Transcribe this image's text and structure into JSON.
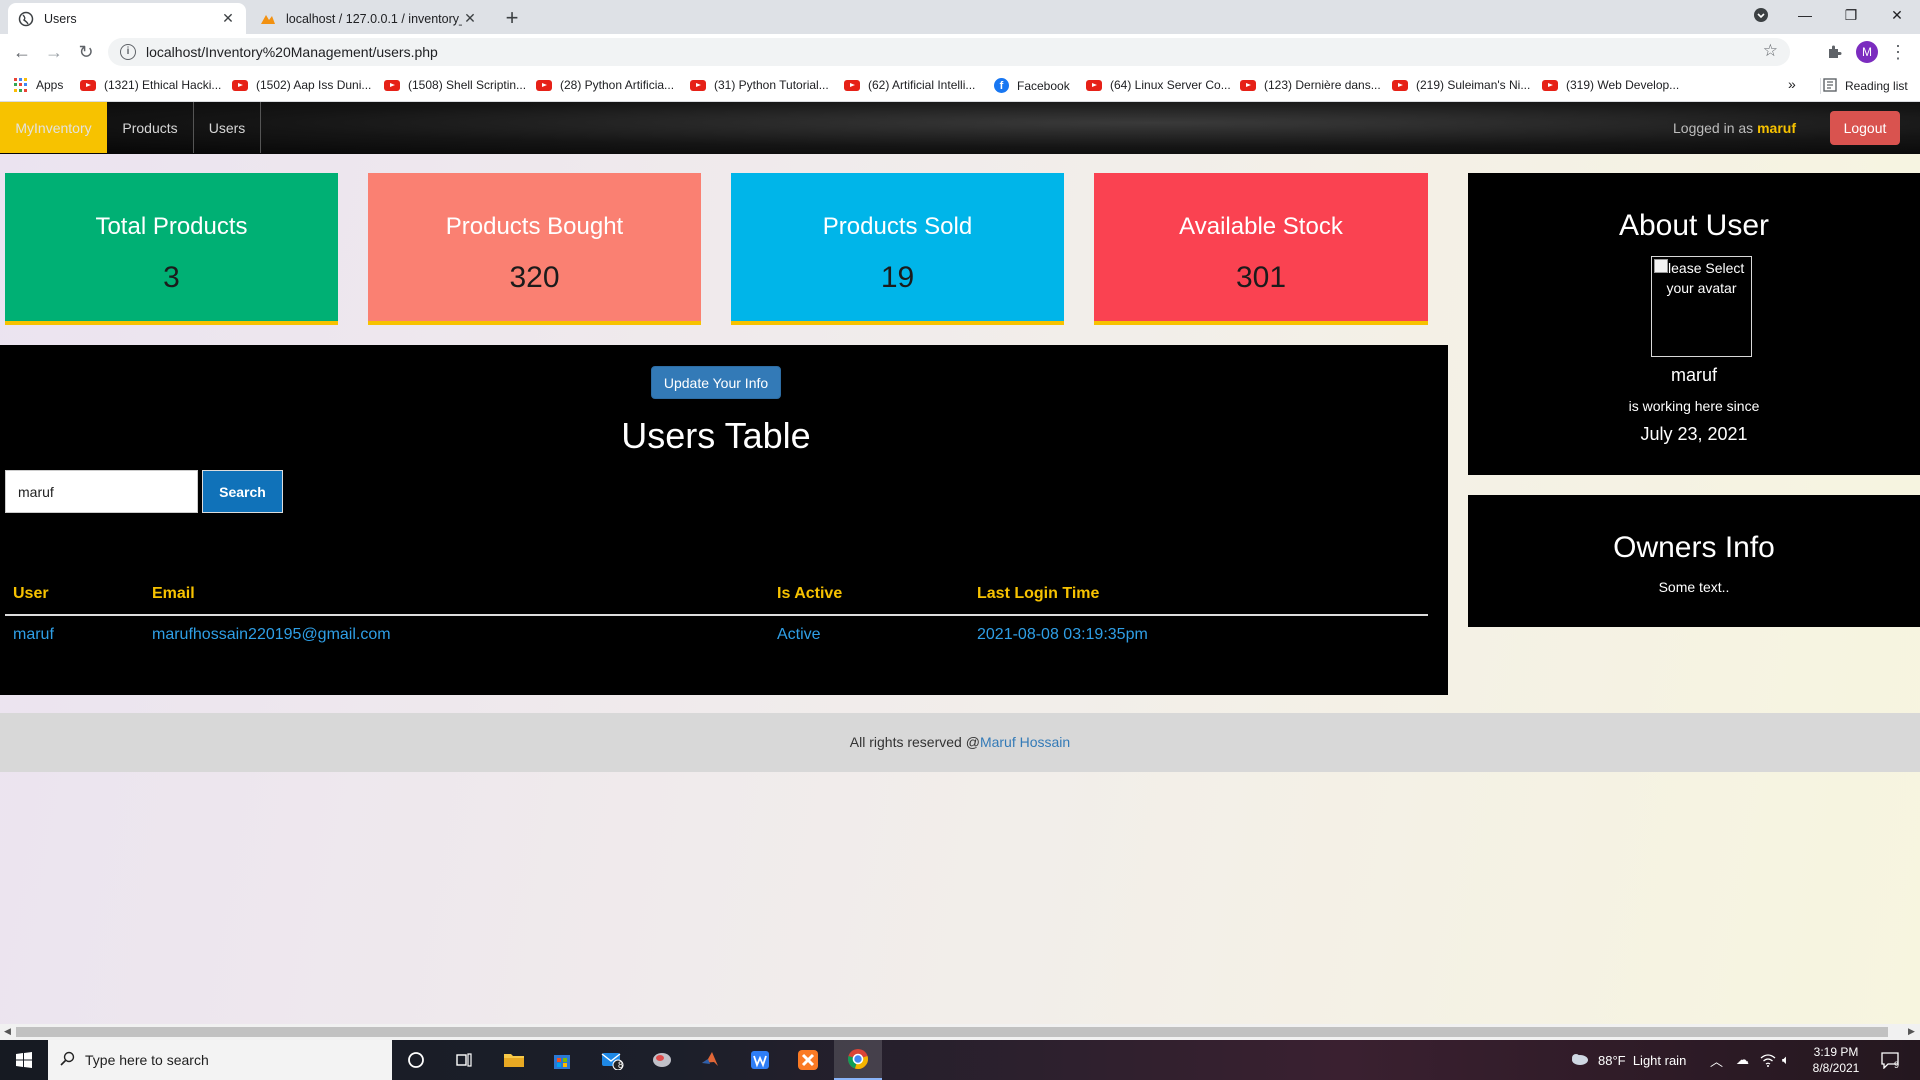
{
  "browser": {
    "tabs": [
      {
        "title": "Users",
        "active": true
      },
      {
        "title": "localhost / 127.0.0.1 / inventory_",
        "active": false
      }
    ],
    "url": "localhost/Inventory%20Management/users.php",
    "profile_initial": "M",
    "bookmarks": [
      {
        "label": "Apps",
        "icon": "apps-grid-icon"
      },
      {
        "label": "(1321) Ethical Hacki...",
        "icon": "youtube-icon"
      },
      {
        "label": "(1502) Aap Iss Duni...",
        "icon": "youtube-icon"
      },
      {
        "label": "(1508) Shell Scriptin...",
        "icon": "youtube-icon"
      },
      {
        "label": "(28) Python Artificia...",
        "icon": "youtube-icon"
      },
      {
        "label": "(31) Python Tutorial...",
        "icon": "youtube-icon"
      },
      {
        "label": "(62) Artificial Intelli...",
        "icon": "youtube-icon"
      },
      {
        "label": "Facebook",
        "icon": "facebook-icon"
      },
      {
        "label": "(64) Linux Server Co...",
        "icon": "youtube-icon"
      },
      {
        "label": "(123) Dernière dans...",
        "icon": "youtube-icon"
      },
      {
        "label": "(219) Suleiman's Ni...",
        "icon": "youtube-icon"
      },
      {
        "label": "(319) Web Develop...",
        "icon": "youtube-icon"
      }
    ],
    "more_bookmarks": "»",
    "reading_list": "Reading list"
  },
  "navbar": {
    "brand": "MyInventory",
    "links": [
      "Products",
      "Users"
    ],
    "logged_in_prefix": "Logged in as",
    "logged_in_user": "maruf",
    "logout_label": "Logout"
  },
  "stats": [
    {
      "title": "Total Products",
      "value": "3",
      "color": "#00b074"
    },
    {
      "title": "Products Bought",
      "value": "320",
      "color": "#fa8072"
    },
    {
      "title": "Products Sold",
      "value": "19",
      "color": "#00b5e9"
    },
    {
      "title": "Available Stock",
      "value": "301",
      "color": "#fa4251"
    }
  ],
  "users": {
    "update_button": "Update Your Info",
    "title": "Users Table",
    "search_value": "maruf",
    "search_button": "Search",
    "columns": [
      "User",
      "Email",
      "Is Active",
      "Last Login Time"
    ],
    "rows": [
      [
        "maruf",
        "marufhossain220195@gmail.com",
        "Active",
        "2021-08-08 03:19:35pm"
      ]
    ]
  },
  "about": {
    "title": "About User",
    "avatar_alt": "Please Select your avatar",
    "name": "maruf",
    "since_text": "is working here since",
    "since_date": "July 23, 2021"
  },
  "owners": {
    "title": "Owners Info",
    "text": "Some text.."
  },
  "footer": {
    "text": "All rights reserved @",
    "link": "Maruf Hossain"
  },
  "taskbar": {
    "search_placeholder": "Type here to search",
    "mail_badge": "8",
    "weather": "88°F  Light rain",
    "time": "3:19 PM",
    "date": "8/8/2021",
    "notification_count": "9"
  }
}
